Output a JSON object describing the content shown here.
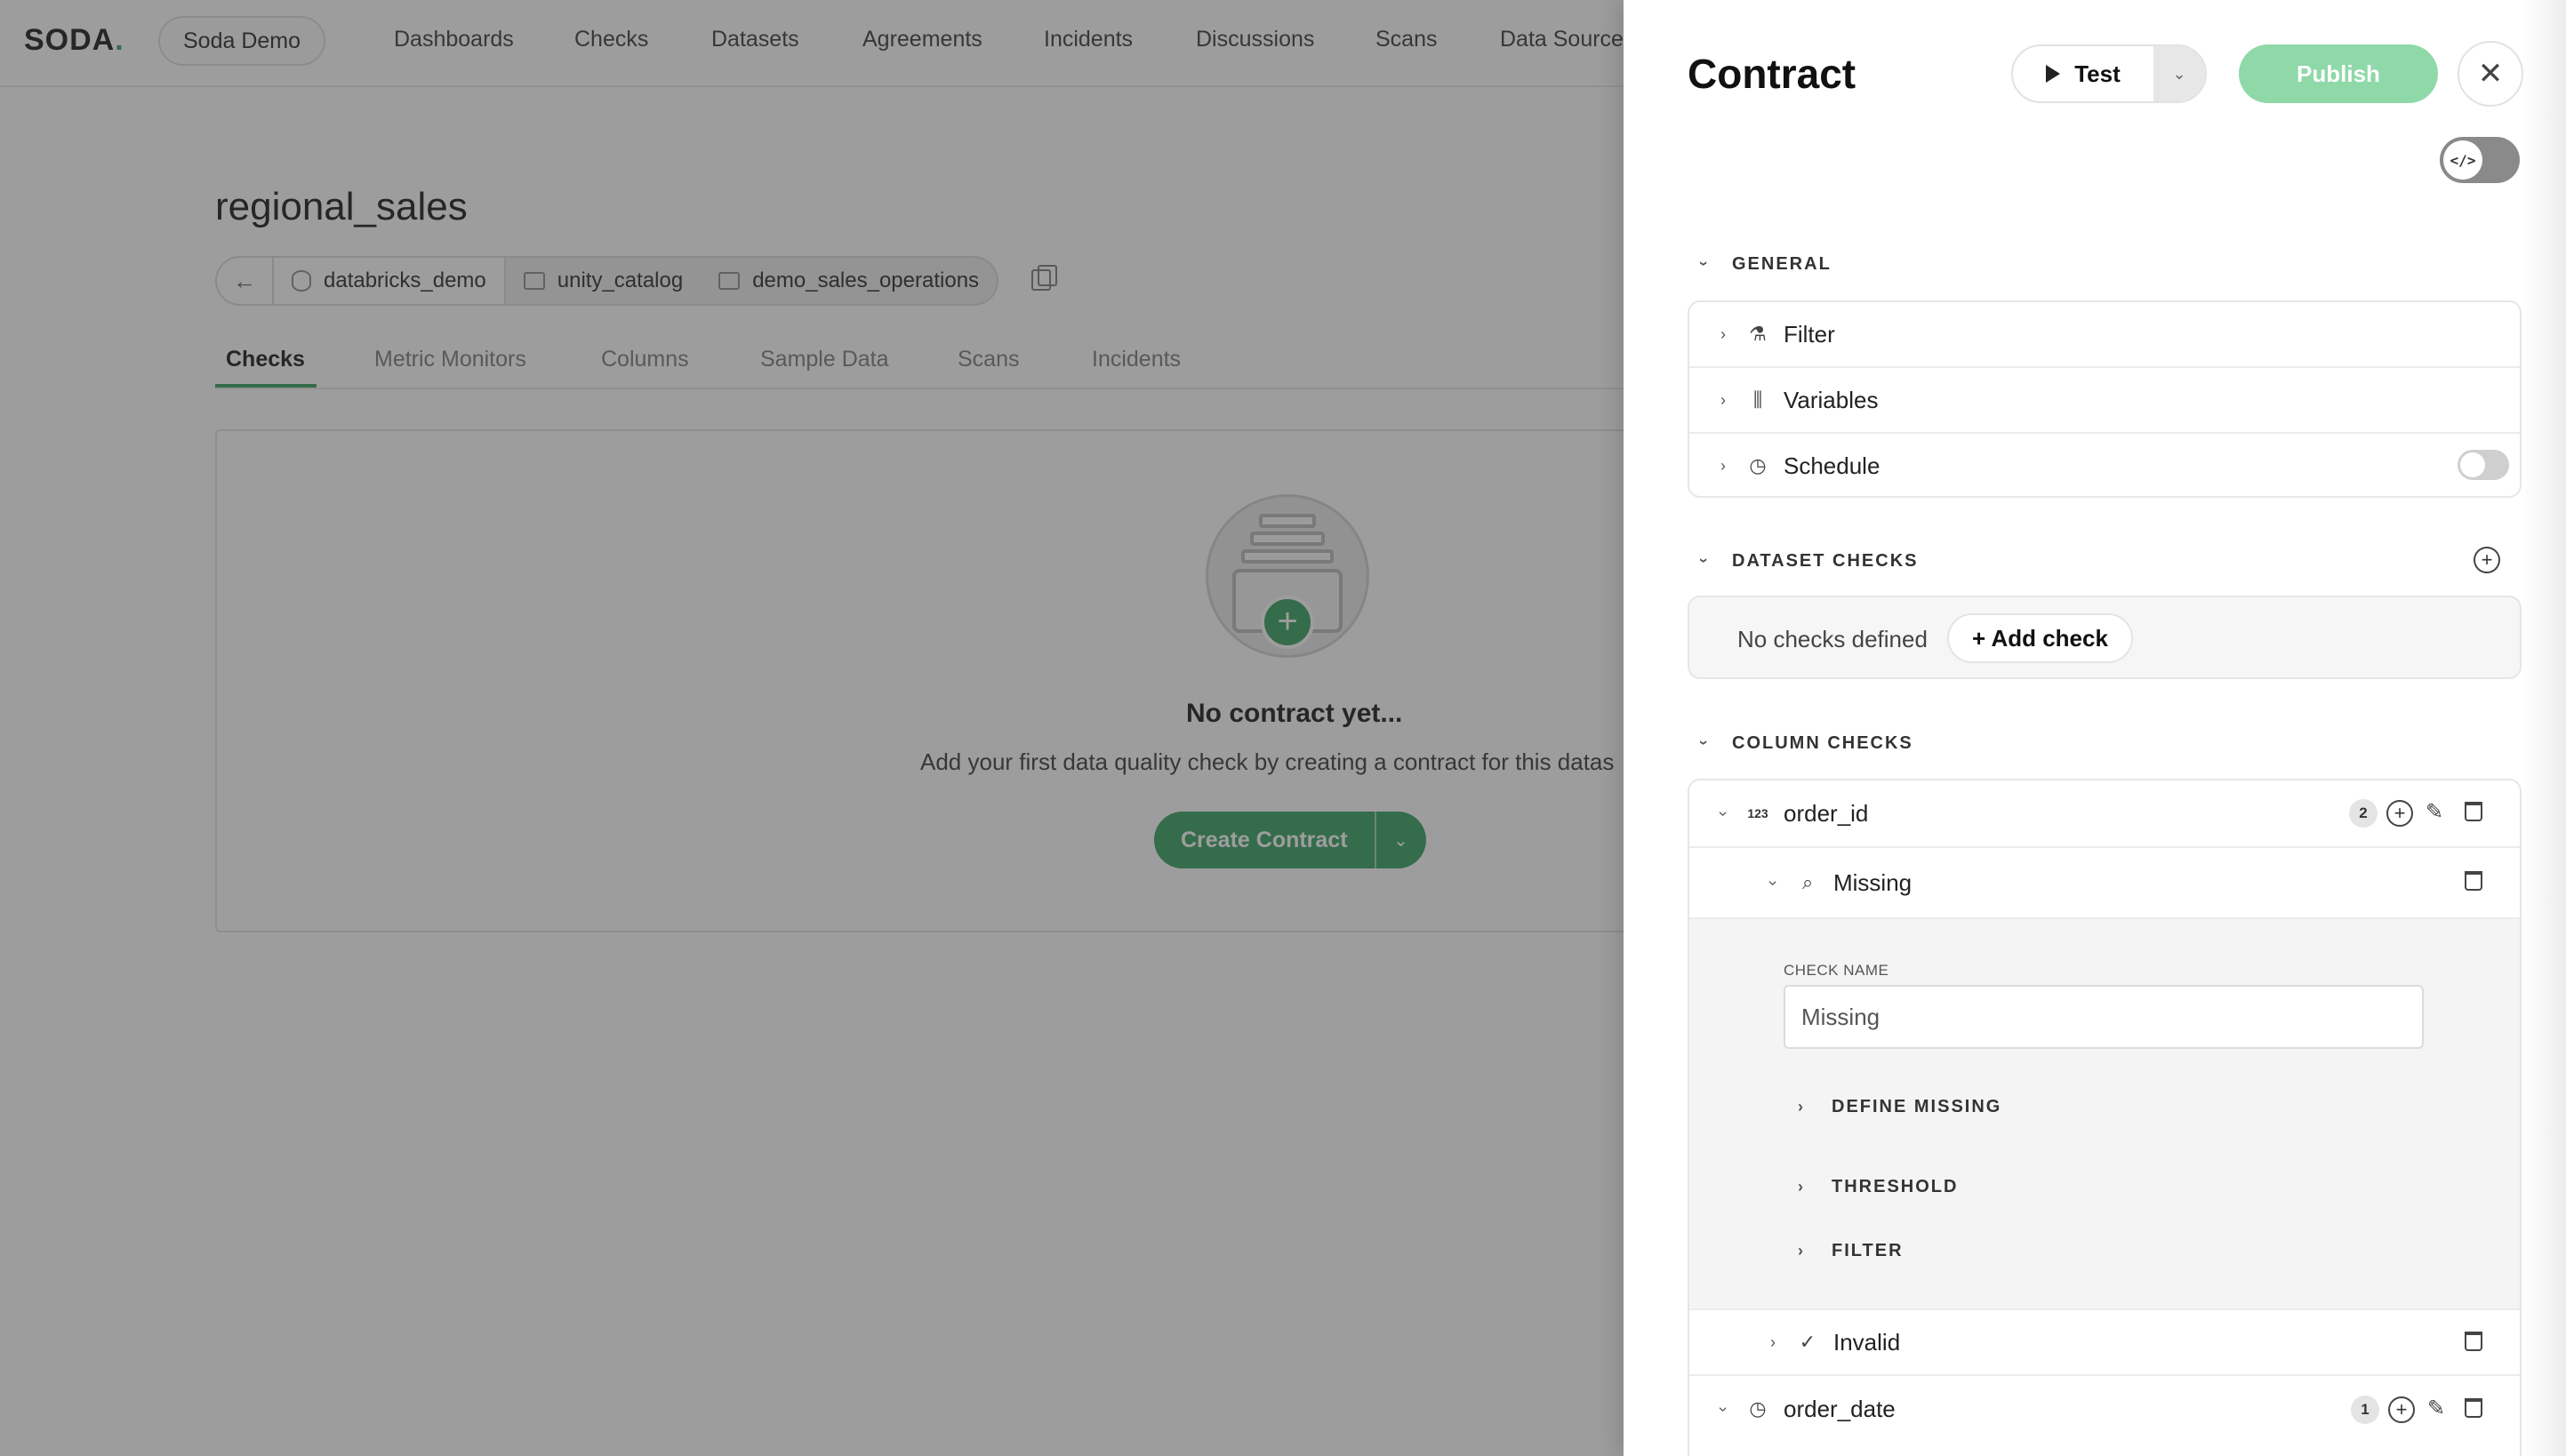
{
  "app": {
    "logo": "SODA",
    "org": "Soda Demo",
    "nav": [
      "Dashboards",
      "Checks",
      "Datasets",
      "Agreements",
      "Incidents",
      "Discussions",
      "Scans",
      "Data Sources"
    ]
  },
  "dataset": {
    "title": "regional_sales",
    "breadcrumb": [
      "databricks_demo",
      "unity_catalog",
      "demo_sales_operations"
    ],
    "tabs": [
      "Checks",
      "Metric Monitors",
      "Columns",
      "Sample Data",
      "Scans",
      "Incidents"
    ],
    "active_tab": "Checks",
    "empty_title": "No contract yet...",
    "empty_subtitle": "Add your first data quality check by creating a contract for this datas",
    "create_button": "Create Contract"
  },
  "drawer": {
    "title": "Contract",
    "test_label": "Test",
    "publish_label": "Publish",
    "code_toggle_icon": "</>",
    "general": {
      "heading": "GENERAL",
      "items": [
        {
          "label": "Filter",
          "icon": "flask-icon"
        },
        {
          "label": "Variables",
          "icon": "sliders-icon"
        },
        {
          "label": "Schedule",
          "icon": "clock-icon"
        }
      ]
    },
    "dataset_checks": {
      "heading": "DATASET CHECKS",
      "empty_text": "No checks defined",
      "add_label": "+ Add check"
    },
    "column_checks": {
      "heading": "COLUMN CHECKS",
      "columns": [
        {
          "name": "order_id",
          "type_badge": "123",
          "count": "2",
          "checks": [
            {
              "name": "Missing",
              "field_label": "CHECK NAME",
              "field_value": "Missing",
              "subsections": [
                "DEFINE MISSING",
                "THRESHOLD",
                "FILTER"
              ]
            },
            {
              "name": "Invalid"
            }
          ]
        },
        {
          "name": "order_date",
          "count": "1"
        }
      ]
    }
  },
  "colors": {
    "accent": "#2e9c5b",
    "publish_disabled": "#8fd8a8",
    "overlay": "#3c3c3c"
  }
}
